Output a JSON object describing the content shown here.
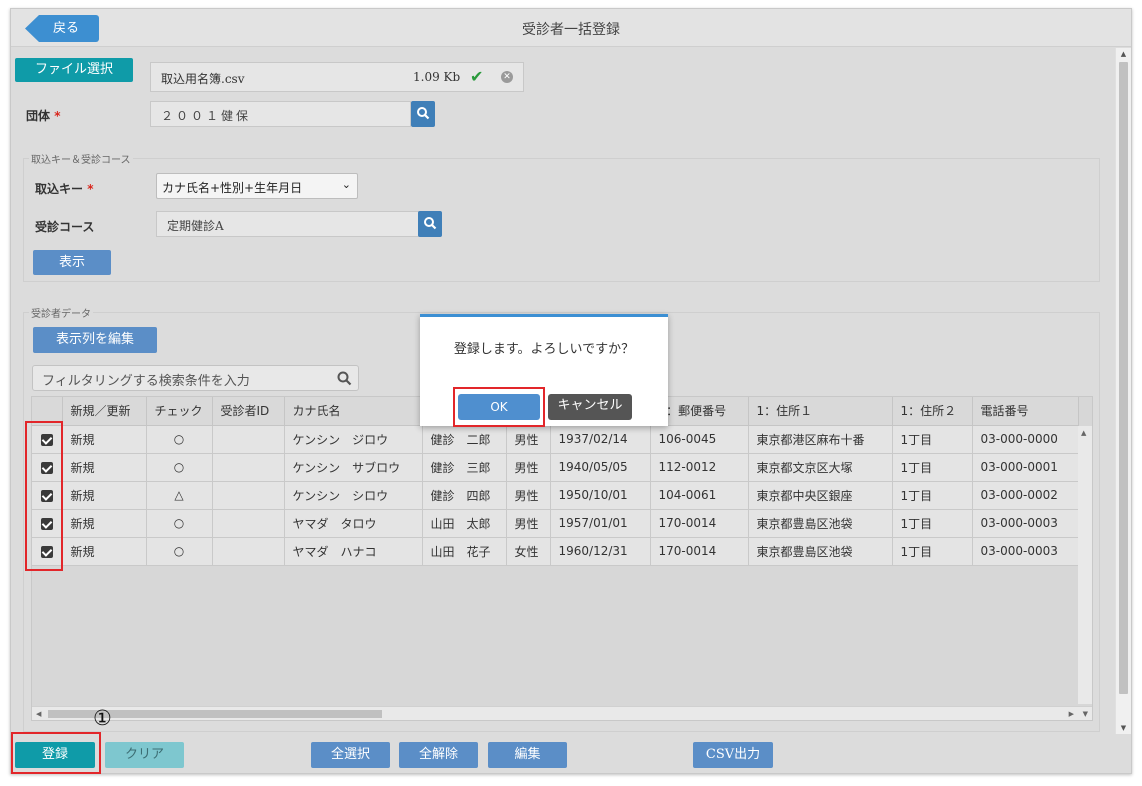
{
  "window": {
    "title": "受診者一括登録",
    "back_label": "戻る"
  },
  "file": {
    "button_label": "ファイル選択",
    "name": "取込用名簿.csv",
    "size": "1.09 Kb",
    "status_icon": "check-icon",
    "remove_icon": "remove-icon"
  },
  "group": {
    "label": "団体",
    "required": "*",
    "value": "２００１健保"
  },
  "import_section": {
    "legend": "取込キー＆受診コース",
    "key_label": "取込キー",
    "key_required": "*",
    "key_value": "カナ氏名+性別+生年月日",
    "course_label": "受診コース",
    "course_value": "定期健診A",
    "show_button": "表示"
  },
  "data_section": {
    "legend": "受診者データ",
    "edit_columns_button": "表示列を編集",
    "filter_placeholder": "フィルタリングする検索条件を入力"
  },
  "grid": {
    "columns": [
      "",
      "新規／更新",
      "チェック",
      "受診者ID",
      "カナ氏名",
      "",
      "",
      "",
      "1：郵便番号",
      "1：住所１",
      "1：住所２",
      "電話番号"
    ],
    "rows": [
      {
        "checked": true,
        "type": "新規",
        "check": "○",
        "id": "",
        "kana": "ケンシン　ジロウ",
        "name": "健診　二郎",
        "sex": "男性",
        "birth": "1937/02/14",
        "zip": "106-0045",
        "addr1": "東京都港区麻布十番",
        "addr2": "1丁目",
        "tel": "03-000-0000"
      },
      {
        "checked": true,
        "type": "新規",
        "check": "○",
        "id": "",
        "kana": "ケンシン　サブロウ",
        "name": "健診　三郎",
        "sex": "男性",
        "birth": "1940/05/05",
        "zip": "112-0012",
        "addr1": "東京都文京区大塚",
        "addr2": "1丁目",
        "tel": "03-000-0001"
      },
      {
        "checked": true,
        "type": "新規",
        "check": "△",
        "id": "",
        "kana": "ケンシン　シロウ",
        "name": "健診　四郎",
        "sex": "男性",
        "birth": "1950/10/01",
        "zip": "104-0061",
        "addr1": "東京都中央区銀座",
        "addr2": "1丁目",
        "tel": "03-000-0002"
      },
      {
        "checked": true,
        "type": "新規",
        "check": "○",
        "id": "",
        "kana": "ヤマダ　タロウ",
        "name": "山田　太郎",
        "sex": "男性",
        "birth": "1957/01/01",
        "zip": "170-0014",
        "addr1": "東京都豊島区池袋",
        "addr2": "1丁目",
        "tel": "03-000-0003"
      },
      {
        "checked": true,
        "type": "新規",
        "check": "○",
        "id": "",
        "kana": "ヤマダ　ハナコ",
        "name": "山田　花子",
        "sex": "女性",
        "birth": "1960/12/31",
        "zip": "170-0014",
        "addr1": "東京都豊島区池袋",
        "addr2": "1丁目",
        "tel": "03-000-0003"
      }
    ]
  },
  "dialog": {
    "message": "登録します。よろしいですか？",
    "ok_label": "OK",
    "cancel_label": "キャンセル"
  },
  "footer": {
    "register": "登録",
    "clear": "クリア",
    "select_all": "全選択",
    "deselect_all": "全解除",
    "edit": "編集",
    "csv_export": "CSV出力"
  },
  "annotation": {
    "step_marker": "①",
    "highlight_color": "#e2262a"
  },
  "colors": {
    "teal": "#0f9ba8",
    "blue": "#5b8ec7",
    "dialog_accent": "#3c8fd3"
  }
}
